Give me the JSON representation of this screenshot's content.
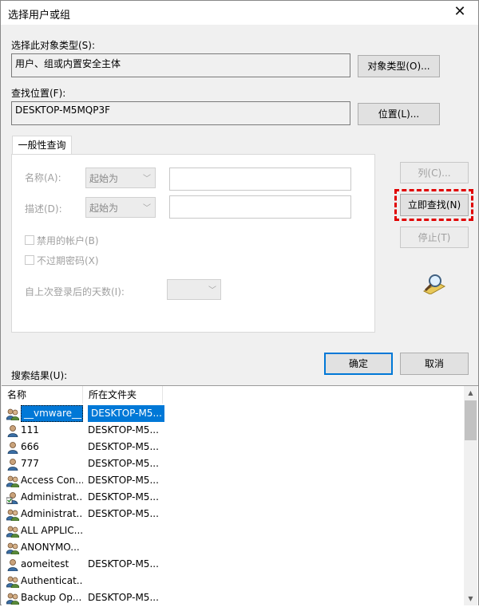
{
  "window": {
    "title": "选择用户或组",
    "close_glyph": "✕"
  },
  "object_type": {
    "label": "选择此对象类型(S):",
    "value": "用户、组或内置安全主体",
    "button": "对象类型(O)..."
  },
  "location": {
    "label": "查找位置(F):",
    "value": "DESKTOP-M5MQP3F",
    "button": "位置(L)..."
  },
  "query": {
    "tab_label": "一般性查询",
    "name_label": "名称(A):",
    "name_match": "起始为",
    "desc_label": "描述(D):",
    "desc_match": "起始为",
    "disabled_accounts": "禁用的帐户(B)",
    "non_expiring": "不过期密码(X)",
    "days_label": "自上次登录后的天数(I):",
    "chevron": "﹀"
  },
  "side_buttons": {
    "columns": "列(C)...",
    "find_now": "立即查找(N)",
    "stop": "停止(T)"
  },
  "dialog_buttons": {
    "ok": "确定",
    "cancel": "取消"
  },
  "results": {
    "label": "搜索结果(U):",
    "columns": [
      "名称",
      "所在文件夹"
    ],
    "rows": [
      {
        "name": "__vmware__",
        "folder": "DESKTOP-M5...",
        "icon": "group-icon",
        "selected": true
      },
      {
        "name": "111",
        "folder": "DESKTOP-M5...",
        "icon": "user-icon"
      },
      {
        "name": "666",
        "folder": "DESKTOP-M5...",
        "icon": "user-icon"
      },
      {
        "name": "777",
        "folder": "DESKTOP-M5...",
        "icon": "user-icon"
      },
      {
        "name": "Access Con...",
        "folder": "DESKTOP-M5...",
        "icon": "group-icon"
      },
      {
        "name": "Administrat...",
        "folder": "DESKTOP-M5...",
        "icon": "admin-user-icon"
      },
      {
        "name": "Administrat...",
        "folder": "DESKTOP-M5...",
        "icon": "group-icon"
      },
      {
        "name": "ALL APPLIC...",
        "folder": "",
        "icon": "group-icon"
      },
      {
        "name": "ANONYMO...",
        "folder": "",
        "icon": "group-icon"
      },
      {
        "name": "aomeitest",
        "folder": "DESKTOP-M5...",
        "icon": "user-icon"
      },
      {
        "name": "Authenticat...",
        "folder": "",
        "icon": "group-icon"
      },
      {
        "name": "Backup Op...",
        "folder": "DESKTOP-M5...",
        "icon": "group-icon"
      }
    ]
  },
  "colors": {
    "accent": "#0078d7",
    "highlight": "#e00000"
  }
}
